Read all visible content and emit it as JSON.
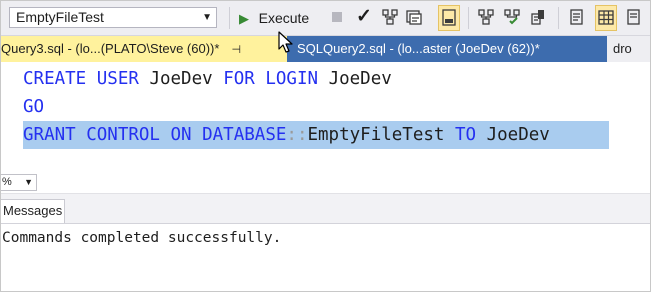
{
  "toolbar": {
    "database_value": "EmptyFileTest",
    "execute_label": "Execute"
  },
  "tabs": {
    "active_label": "Query3.sql - (lo...(PLATO\\Steve (60))*",
    "inactive_label": "SQLQuery2.sql - (lo...aster (JoeDev (62))*",
    "overflow_label": "dro"
  },
  "editor": {
    "line1": {
      "kw1": "CREATE USER",
      "id1": " JoeDev ",
      "kw2": "FOR LOGIN",
      "id2": " JoeDev"
    },
    "line2": {
      "kw1": "GO"
    },
    "line3": {
      "kw1": "GRANT CONTROL ON DATABASE",
      "sep": "::",
      "id1": "EmptyFileTest ",
      "kw2": "TO",
      "id2": " JoeDev"
    }
  },
  "zoom": {
    "value": "%"
  },
  "results": {
    "messages_tab_label": "Messages",
    "output": "Commands completed successfully."
  },
  "colors": {
    "keyword": "#2430f0",
    "selection": "#a9ccef",
    "active_tab": "#fff29d",
    "inactive_tab": "#3d6cae",
    "execute_icon": "#388a34"
  }
}
